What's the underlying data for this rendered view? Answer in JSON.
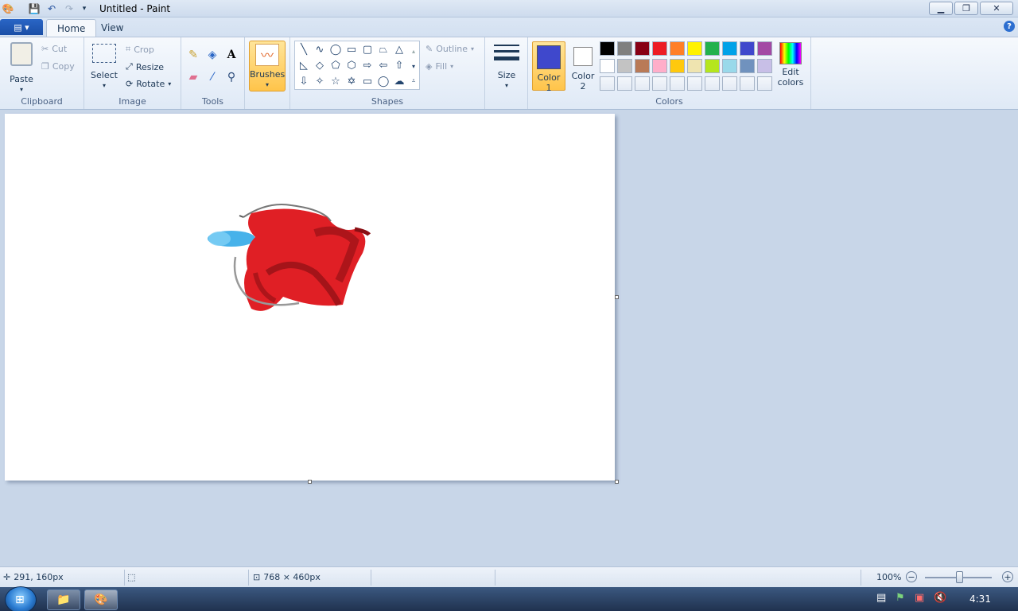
{
  "window": {
    "title": "Untitled - Paint",
    "buttons": {
      "minimize": "▁",
      "maximize": "❐",
      "close": "✕"
    }
  },
  "quick_access": {
    "icons": [
      "save-icon",
      "undo-icon",
      "redo-icon",
      "customize-icon"
    ]
  },
  "tabs": [
    {
      "label": "Home",
      "active": true
    },
    {
      "label": "View",
      "active": false
    }
  ],
  "help": "?",
  "ribbon": {
    "clipboard": {
      "label": "Clipboard",
      "paste": "Paste",
      "cut": "Cut",
      "copy": "Copy"
    },
    "image": {
      "label": "Image",
      "select": "Select",
      "crop": "Crop",
      "resize": "Resize",
      "rotate": "Rotate"
    },
    "tools": {
      "label": "Tools"
    },
    "brushes": {
      "label": "Brushes"
    },
    "shapes": {
      "label": "Shapes",
      "outline": "Outline",
      "fill": "Fill"
    },
    "size": {
      "label": "Size"
    },
    "colors": {
      "label": "Colors",
      "color1": "Color\n1",
      "color1_line1": "Color",
      "color1_line2": "1",
      "color2_line1": "Color",
      "color2_line2": "2",
      "edit_line1": "Edit",
      "edit_line2": "colors",
      "color1_value": "#3f48cc",
      "color2_value": "#ffffff",
      "palette_row1": [
        "#000000",
        "#7f7f7f",
        "#880015",
        "#ed1c24",
        "#ff7f27",
        "#fff200",
        "#22b14c",
        "#00a2e8",
        "#3f48cc",
        "#a349a4"
      ],
      "palette_row2": [
        "#ffffff",
        "#c3c3c3",
        "#b97a57",
        "#ffaec9",
        "#ffc90e",
        "#efe4b0",
        "#b5e61d",
        "#99d9ea",
        "#7092be",
        "#c8bfe7"
      ]
    }
  },
  "status": {
    "cursor_pos": "291, 160px",
    "canvas_size": "768 × 460px",
    "zoom": "100%"
  },
  "taskbar": {
    "clock": "4:31"
  }
}
